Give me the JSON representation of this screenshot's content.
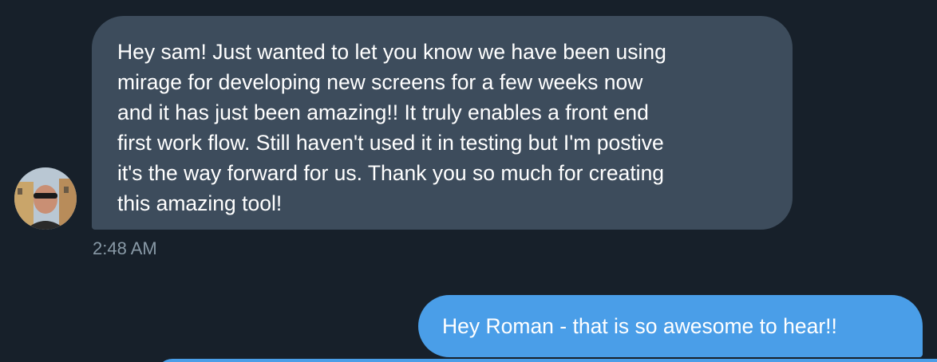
{
  "conversation": {
    "incoming": {
      "text": "Hey sam! Just wanted to let you know we have been using\nmirage for developing new screens for a few weeks now\nand it has just been amazing!! It truly enables a front end\nfirst work flow. Still haven't used it in testing but I'm postive\nit's the way forward for us. Thank you so much for creating\nthis amazing tool!",
      "timestamp": "2:48 AM",
      "avatar_icon": "user-photo-avatar"
    },
    "outgoing": {
      "text": "Hey Roman - that is so awesome to hear!!"
    }
  },
  "colors": {
    "background": "#17202a",
    "incoming_bubble": "#3d4c5c",
    "outgoing_bubble": "#4a9ee8",
    "timestamp": "#8899a6",
    "message_text": "#ffffff"
  }
}
